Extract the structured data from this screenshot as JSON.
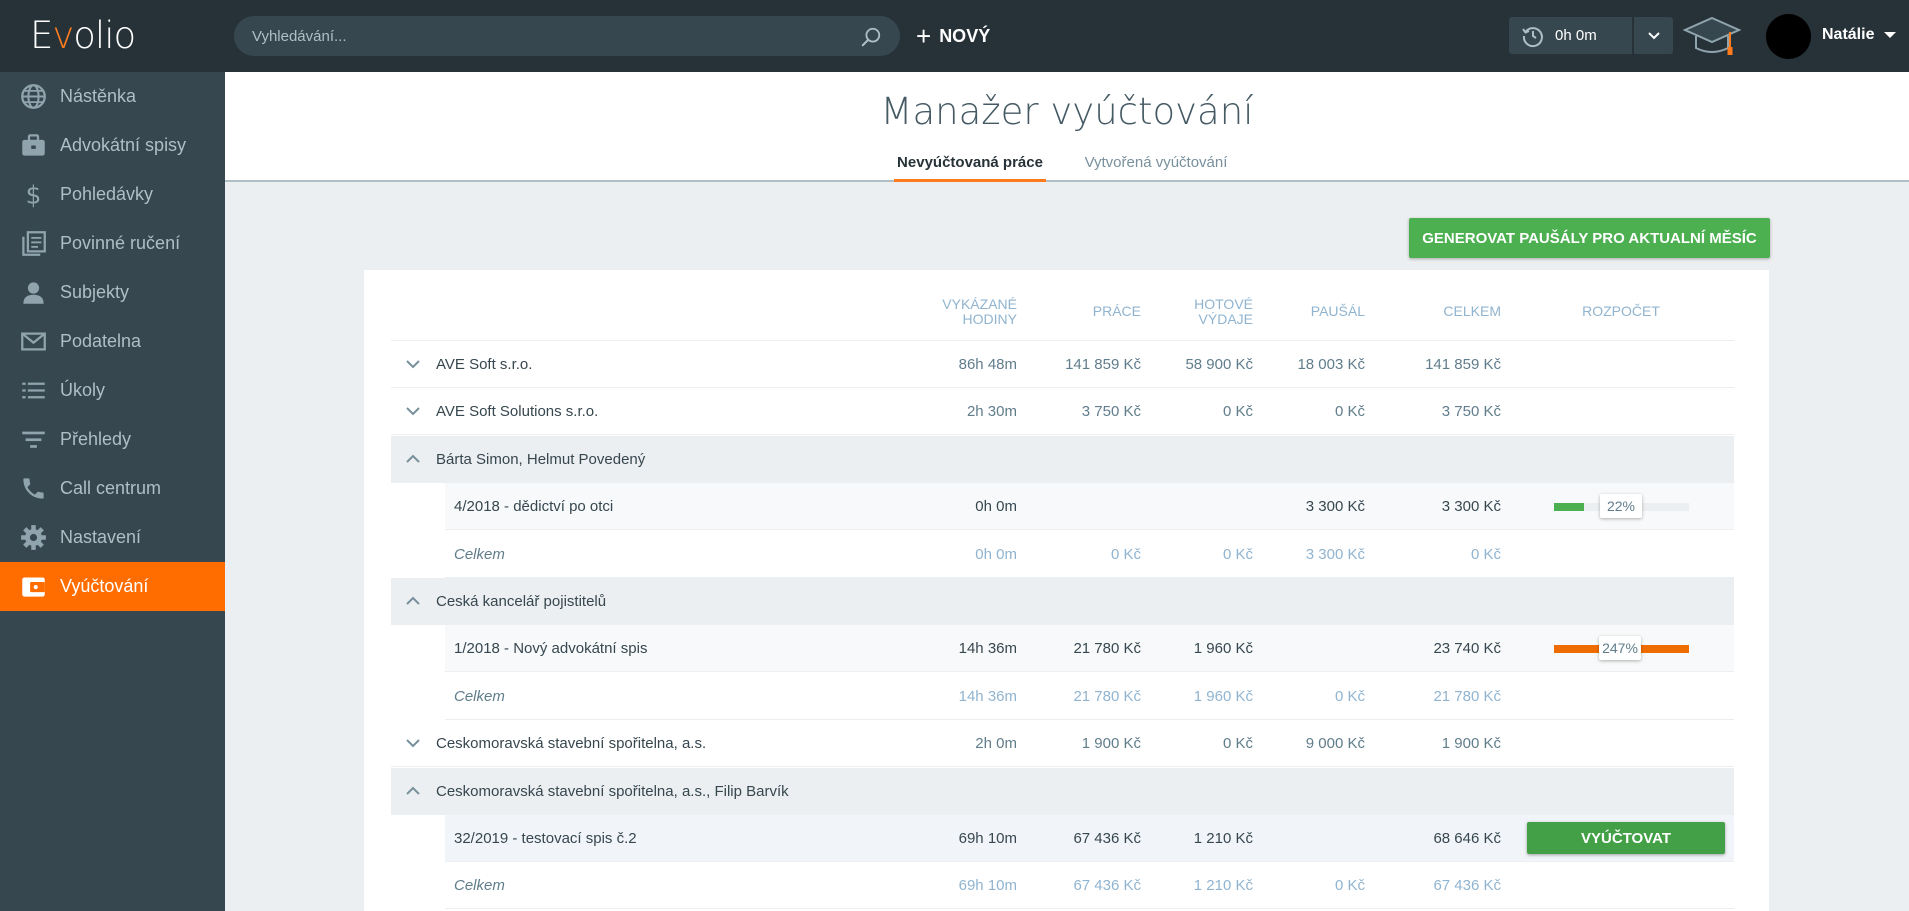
{
  "app": {
    "logo": "Evolio"
  },
  "topbar": {
    "search_placeholder": "Vyhledávání...",
    "new_label": "NOVÝ",
    "timer": "0h 0m",
    "user_name": "Natálie"
  },
  "sidebar": {
    "items": [
      {
        "label": "Nástěnka",
        "icon": "globe-icon"
      },
      {
        "label": "Advokátní spisy",
        "icon": "briefcase-icon"
      },
      {
        "label": "Pohledávky",
        "icon": "dollar-icon"
      },
      {
        "label": "Povinné ručení",
        "icon": "documents-icon"
      },
      {
        "label": "Subjekty",
        "icon": "person-icon"
      },
      {
        "label": "Podatelna",
        "icon": "mail-icon"
      },
      {
        "label": "Úkoly",
        "icon": "list-icon"
      },
      {
        "label": "Přehledy",
        "icon": "filter-icon"
      },
      {
        "label": "Call centrum",
        "icon": "phone-icon"
      },
      {
        "label": "Nastavení",
        "icon": "gear-icon"
      },
      {
        "label": "Vyúčtování",
        "icon": "wallet-icon",
        "active": true
      }
    ]
  },
  "page": {
    "title": "Manažer vyúčtování",
    "tabs": [
      "Nevyúčtovaná práce",
      "Vytvořená vyúčtování"
    ],
    "active_tab": 0,
    "generate_button": "GENEROVAT PAUŠÁLY PRO AKTUALNÍ MĚSÍC"
  },
  "table": {
    "headers": {
      "hours_1": "VYKÁZANÉ",
      "hours_2": "HODINY",
      "work": "PRÁCE",
      "cash_1": "HOTOVÉ",
      "cash_2": "VÝDAJE",
      "flat": "PAUŠÁL",
      "total": "CELKEM",
      "budget": "ROZPOČET"
    },
    "rows": [
      {
        "type": "group",
        "expanded": false,
        "name": "AVE Soft s.r.o.",
        "hours": "86h 48m",
        "work": "141 859 Kč",
        "cash": "58 900 Kč",
        "flat": "18 003 Kč",
        "total": "141 859 Kč"
      },
      {
        "type": "group",
        "expanded": false,
        "name": "AVE Soft Solutions s.r.o.",
        "hours": "2h 30m",
        "work": "3 750 Kč",
        "cash": "0 Kč",
        "flat": "0 Kč",
        "total": "3 750 Kč"
      },
      {
        "type": "group",
        "expanded": true,
        "name": "Bárta Simon, Helmut Povedený"
      },
      {
        "type": "sub",
        "name": "4/2018 - dědictví po otci",
        "hours": "0h 0m",
        "flat": "3 300 Kč",
        "total": "3 300 Kč",
        "budget_label": "22%",
        "budget_fraction": 0.22,
        "budget_color": "#4caf50"
      },
      {
        "type": "total",
        "name": "Celkem",
        "hours": "0h 0m",
        "work": "0 Kč",
        "cash": "0 Kč",
        "flat": "3 300 Kč",
        "total": "0 Kč"
      },
      {
        "type": "group",
        "expanded": true,
        "name": "Ceská kancelář pojistitelů"
      },
      {
        "type": "sub",
        "name": "1/2018 - Nový advokátní spis",
        "hours": "14h 36m",
        "work": "21 780 Kč",
        "cash": "1 960 Kč",
        "total": "23 740 Kč",
        "budget_label": "247%",
        "budget_fraction": 1.0,
        "budget_color": "#ef6c00"
      },
      {
        "type": "total",
        "name": "Celkem",
        "hours": "14h 36m",
        "work": "21 780 Kč",
        "cash": "1 960 Kč",
        "flat": "0 Kč",
        "total": "21 780 Kč"
      },
      {
        "type": "group",
        "expanded": false,
        "name": "Ceskomoravská stavební spořitelna, a.s.",
        "hours": "2h 0m",
        "work": "1 900 Kč",
        "cash": "0 Kč",
        "flat": "9 000 Kč",
        "total": "1 900 Kč"
      },
      {
        "type": "group",
        "expanded": true,
        "name": "Ceskomoravská stavební spořitelna, a.s., Filip Barvík"
      },
      {
        "type": "sub",
        "name": "32/2019 - testovací spis č.2",
        "hours": "69h 10m",
        "work": "67 436 Kč",
        "cash": "1 210 Kč",
        "total": "68 646 Kč",
        "action": "VYÚČTOVAT"
      },
      {
        "type": "total",
        "name": "Celkem",
        "hours": "69h 10m",
        "work": "67 436 Kč",
        "cash": "1 210 Kč",
        "flat": "0 Kč",
        "total": "67 436 Kč"
      }
    ]
  }
}
